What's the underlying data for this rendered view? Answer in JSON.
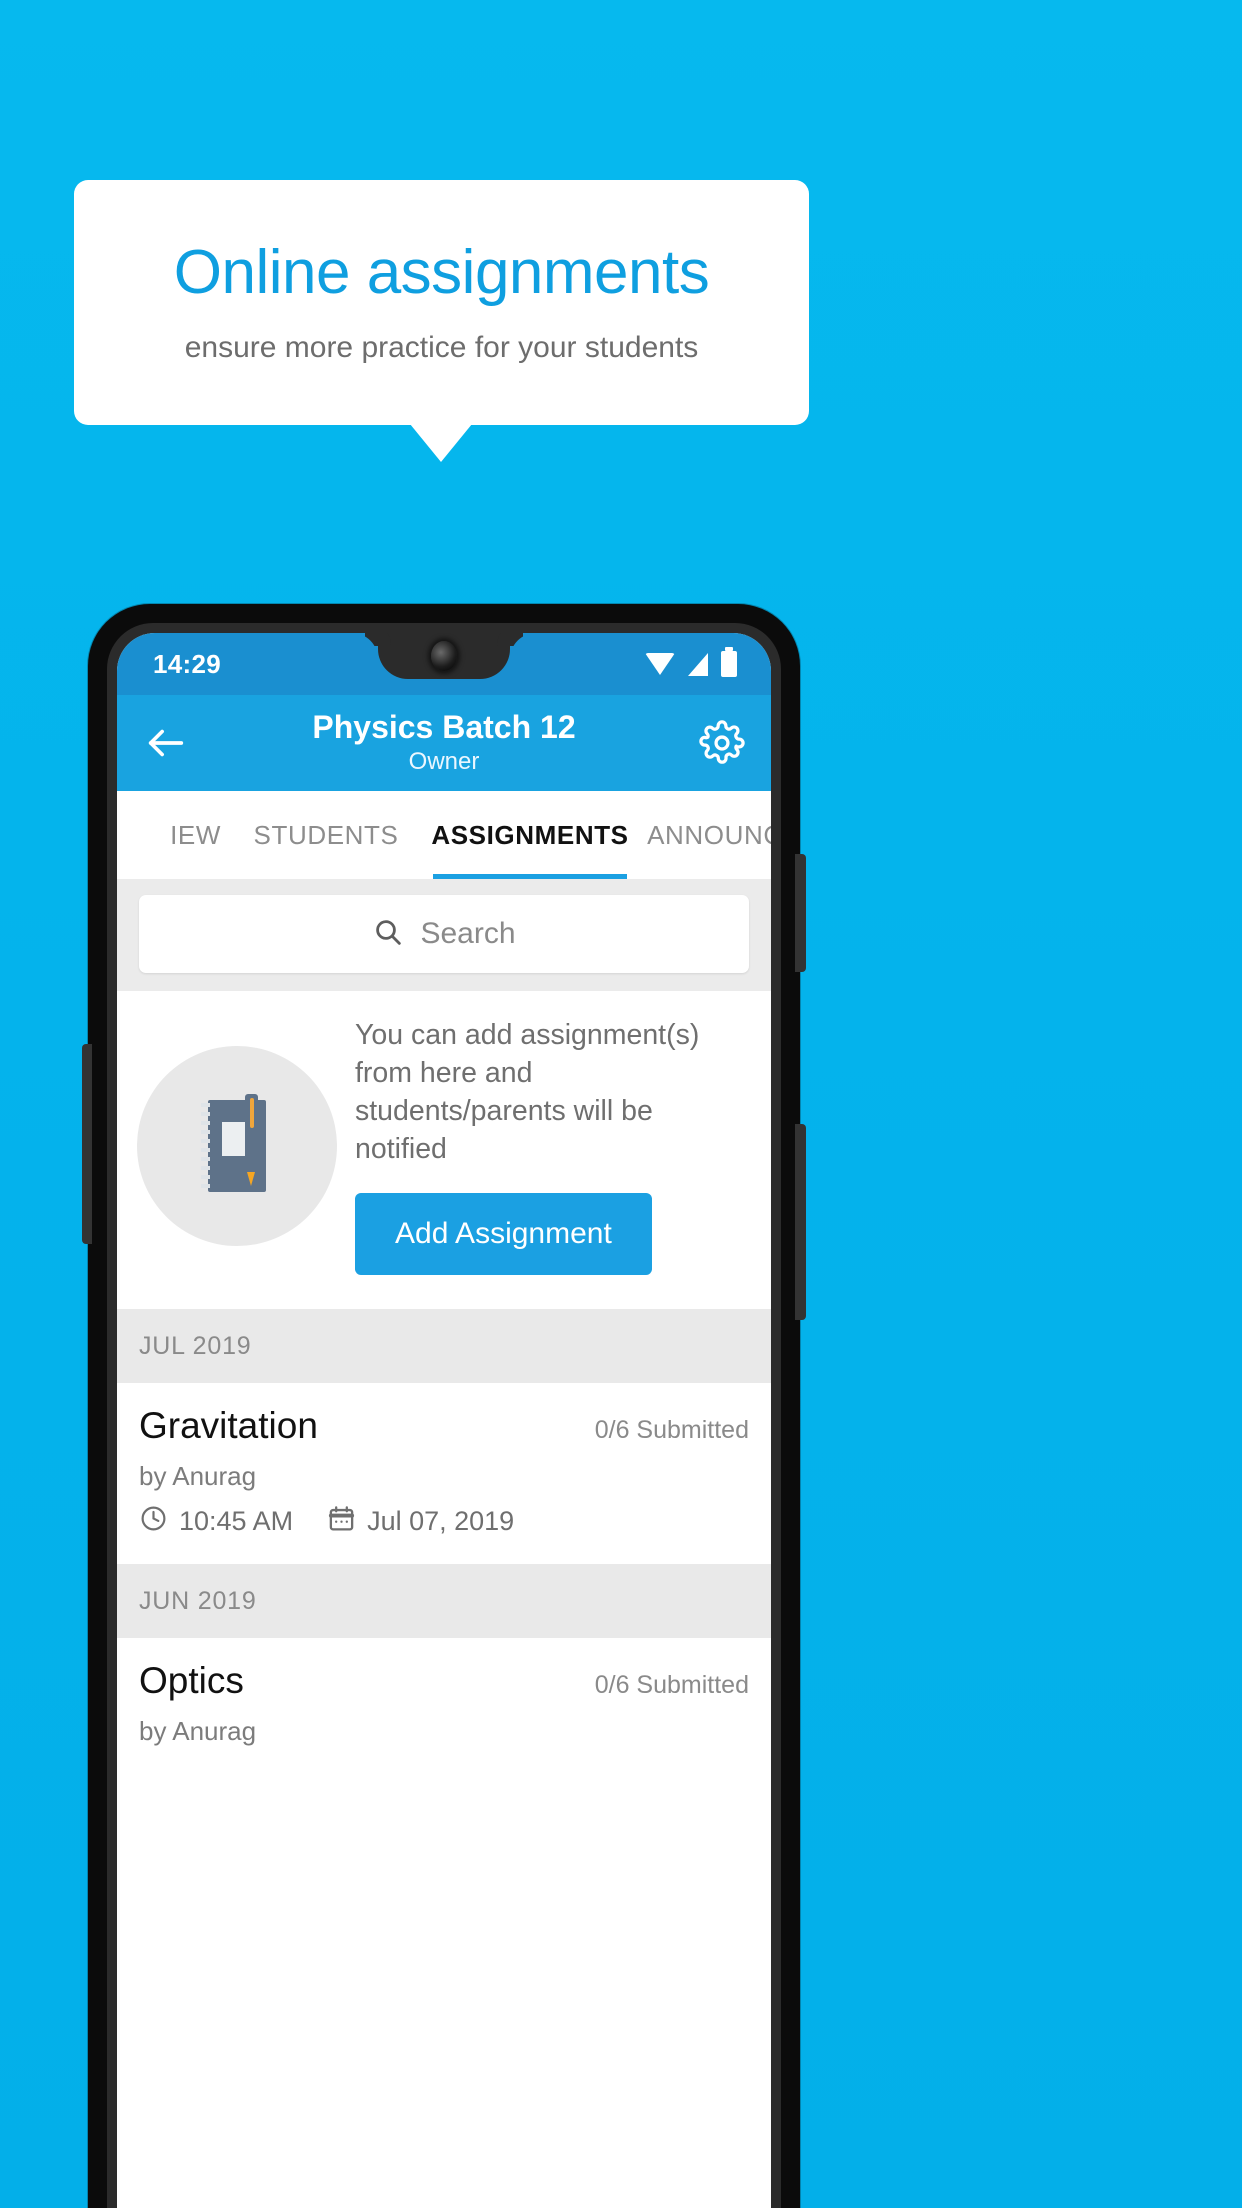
{
  "promo": {
    "title": "Online assignments",
    "subtitle": "ensure more practice for your students"
  },
  "colors": {
    "background": "#04b3ec",
    "accent": "#1ba0e2",
    "appbar": "#19a3e0",
    "statusbar": "#1a8fd0",
    "title_blue": "#0f9fe0"
  },
  "phone": {
    "statusbar": {
      "time": "14:29",
      "icons": [
        "wifi-icon",
        "signal-icon",
        "battery-icon"
      ]
    },
    "appbar": {
      "back_icon": "back-arrow-icon",
      "title": "Physics Batch 12",
      "subtitle": "Owner",
      "settings_icon": "gear-icon"
    },
    "tabs": [
      {
        "label": "IEW",
        "active": false
      },
      {
        "label": "STUDENTS",
        "active": false
      },
      {
        "label": "ASSIGNMENTS",
        "active": true
      },
      {
        "label": "ANNOUNCEM",
        "active": false
      }
    ],
    "search": {
      "icon": "search-icon",
      "placeholder": "Search",
      "value": ""
    },
    "empty_state": {
      "illustration": "notebook-and-pen-icon",
      "message": "You can add assignment(s) from here and students/parents will be notified",
      "button_label": "Add Assignment"
    },
    "sections": [
      {
        "month": "JUL 2019",
        "items": [
          {
            "title": "Gravitation",
            "submitted": "0/6 Submitted",
            "author": "by Anurag",
            "time_icon": "clock-icon",
            "time": "10:45 AM",
            "date_icon": "calendar-icon",
            "date": "Jul 07, 2019"
          }
        ]
      },
      {
        "month": "JUN 2019",
        "items": [
          {
            "title": "Optics",
            "submitted": "0/6 Submitted",
            "author": "by Anurag",
            "time_icon": "clock-icon",
            "time": "",
            "date_icon": "calendar-icon",
            "date": ""
          }
        ]
      }
    ]
  }
}
